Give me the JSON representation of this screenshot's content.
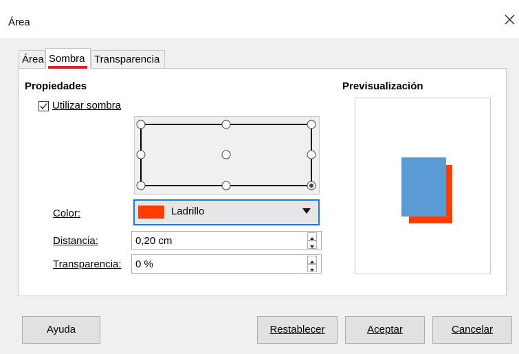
{
  "window": {
    "title": "Área"
  },
  "tabs": [
    {
      "label": "Área"
    },
    {
      "label": "Sombra"
    },
    {
      "label": "Transparencia"
    }
  ],
  "properties": {
    "title": "Propiedades",
    "use_shadow_label": "Utilizar sombra",
    "use_shadow_checked": true,
    "shadow_position_selected": "bottom-right",
    "color_label": "Color:",
    "color_value": "Ladrillo",
    "color_hex": "#ff3d00",
    "distance_label": "Distancia:",
    "distance_value": "0,20 cm",
    "transparency_label": "Transparencia:",
    "transparency_value": "0 %"
  },
  "preview": {
    "title": "Previsualización",
    "object_color": "#5a9bd5",
    "shadow_color": "#ff3d00"
  },
  "buttons": {
    "help": "Ayuda",
    "reset": "Restablecer",
    "ok": "Aceptar",
    "cancel": "Cancelar"
  },
  "accent": {
    "focus_blue": "#1e7ad6",
    "tab_underline": "#e81b23"
  }
}
